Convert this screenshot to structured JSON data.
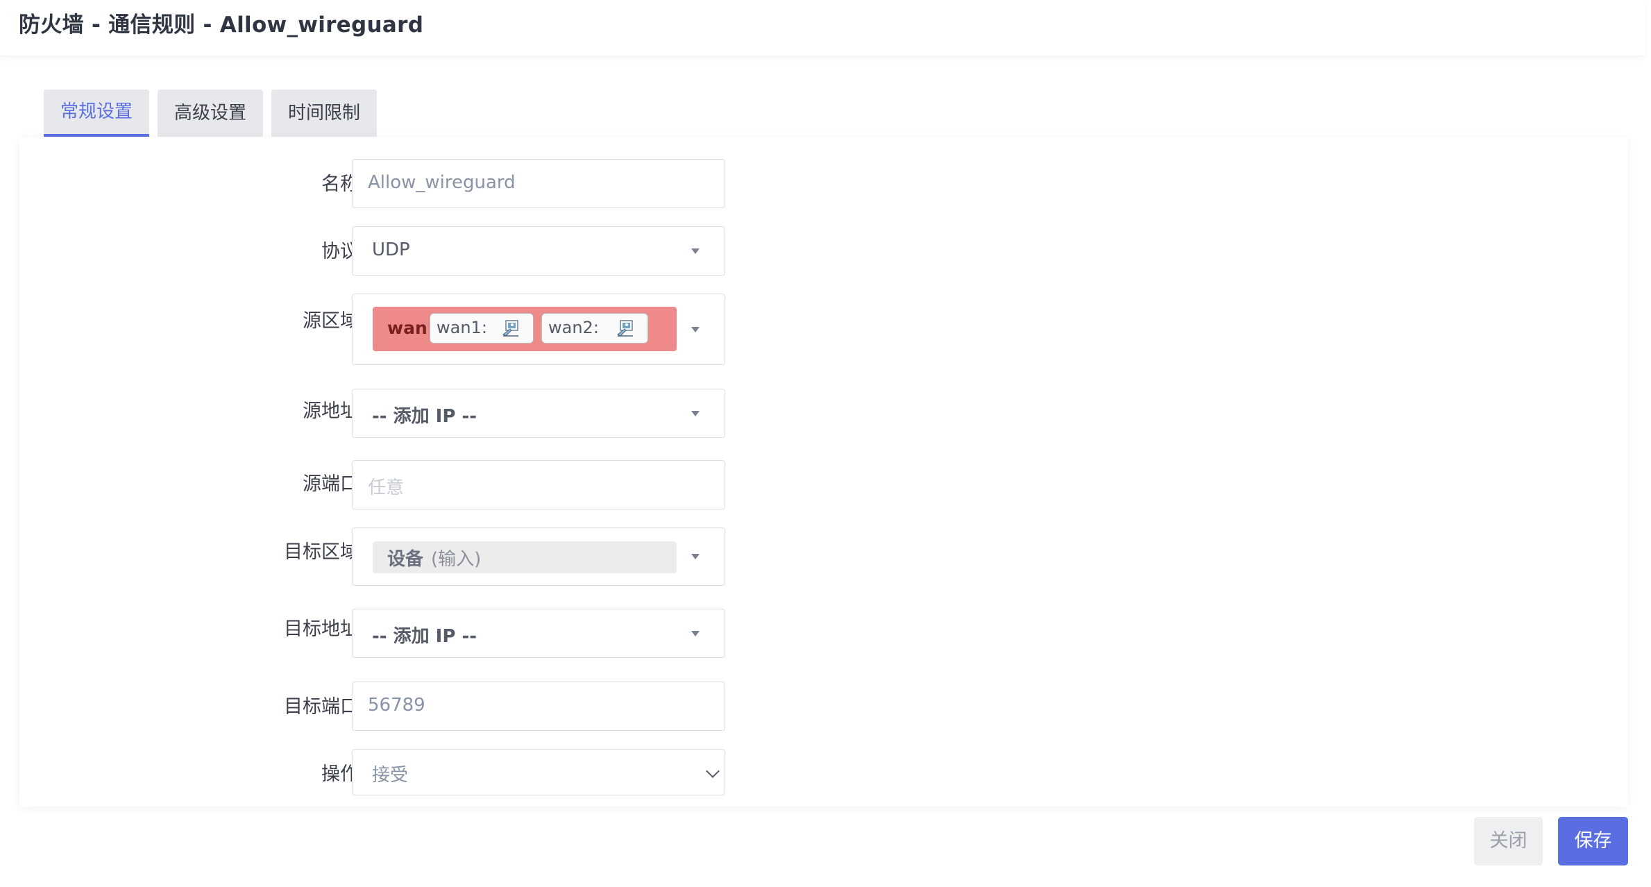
{
  "dialog": {
    "title": "防火墙 - 通信规则 - Allow_wireguard"
  },
  "tabs": [
    {
      "label": "常规设置",
      "active": true
    },
    {
      "label": "高级设置",
      "active": false
    },
    {
      "label": "时间限制",
      "active": false
    }
  ],
  "form": {
    "name": {
      "label": "名称",
      "value": "Allow_wireguard"
    },
    "protocol": {
      "label": "协议",
      "value": "UDP"
    },
    "source_zone": {
      "label": "源区域",
      "zone": "wan",
      "zone_color": "#ee8a8a",
      "interfaces": [
        {
          "label": "wan1:",
          "icon": "network-interface-icon"
        },
        {
          "label": "wan2:",
          "icon": "network-interface-icon"
        }
      ]
    },
    "source_address": {
      "label": "源地址",
      "value": "-- 添加 IP --"
    },
    "source_port": {
      "label": "源端口",
      "placeholder": "任意"
    },
    "dest_zone": {
      "label": "目标区域",
      "zone": "设备",
      "sub": "(输入)"
    },
    "dest_address": {
      "label": "目标地址",
      "value": "-- 添加 IP --"
    },
    "dest_port": {
      "label": "目标端口",
      "value": "56789"
    },
    "action": {
      "label": "操作",
      "value": "接受"
    }
  },
  "footer": {
    "close_label": "关闭",
    "save_label": "保存"
  },
  "colors": {
    "accent": "#5b6ee1",
    "zone_wan": "#ee8a8a"
  }
}
